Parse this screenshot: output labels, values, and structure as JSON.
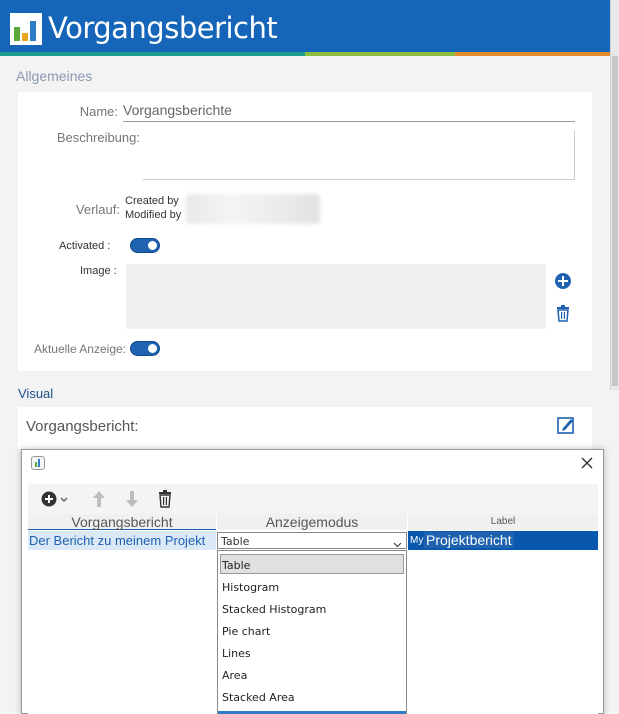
{
  "header": {
    "title": "Vorgangsbericht",
    "bg_color": "#1565b9"
  },
  "general": {
    "section_title": "Allgemeines",
    "name_label": "Name:",
    "name_value": "Vorgangsberichte",
    "description_label": "Beschreibung:",
    "history_label": "Verlauf:",
    "created_by": "Created by",
    "modified_by": "Modified by",
    "activated_label": "Activated :",
    "image_label": "Image :",
    "current_display_label": "Aktuelle Anzeige:"
  },
  "visual": {
    "section_title": "Visual",
    "report_label": "Vorgangsbericht:"
  },
  "dialog": {
    "columns": [
      "Vorgangsbericht",
      "Anzeigemodus",
      "Label"
    ],
    "row": {
      "report": "Der Bericht zu meinem Projekt",
      "mode": "Table",
      "label_prefix": "My",
      "label": "Projektbericht"
    },
    "dropdown_options": [
      "Table",
      "Histogram",
      "Stacked Histogram",
      "Pie chart",
      "Lines",
      "Area",
      "Stacked Area"
    ],
    "selected_option": "Table"
  },
  "colors": {
    "accent": "#1565b9",
    "selection": "#0a58ad",
    "section_label": "#8a9ab0",
    "visual_label": "#1d4e89"
  }
}
